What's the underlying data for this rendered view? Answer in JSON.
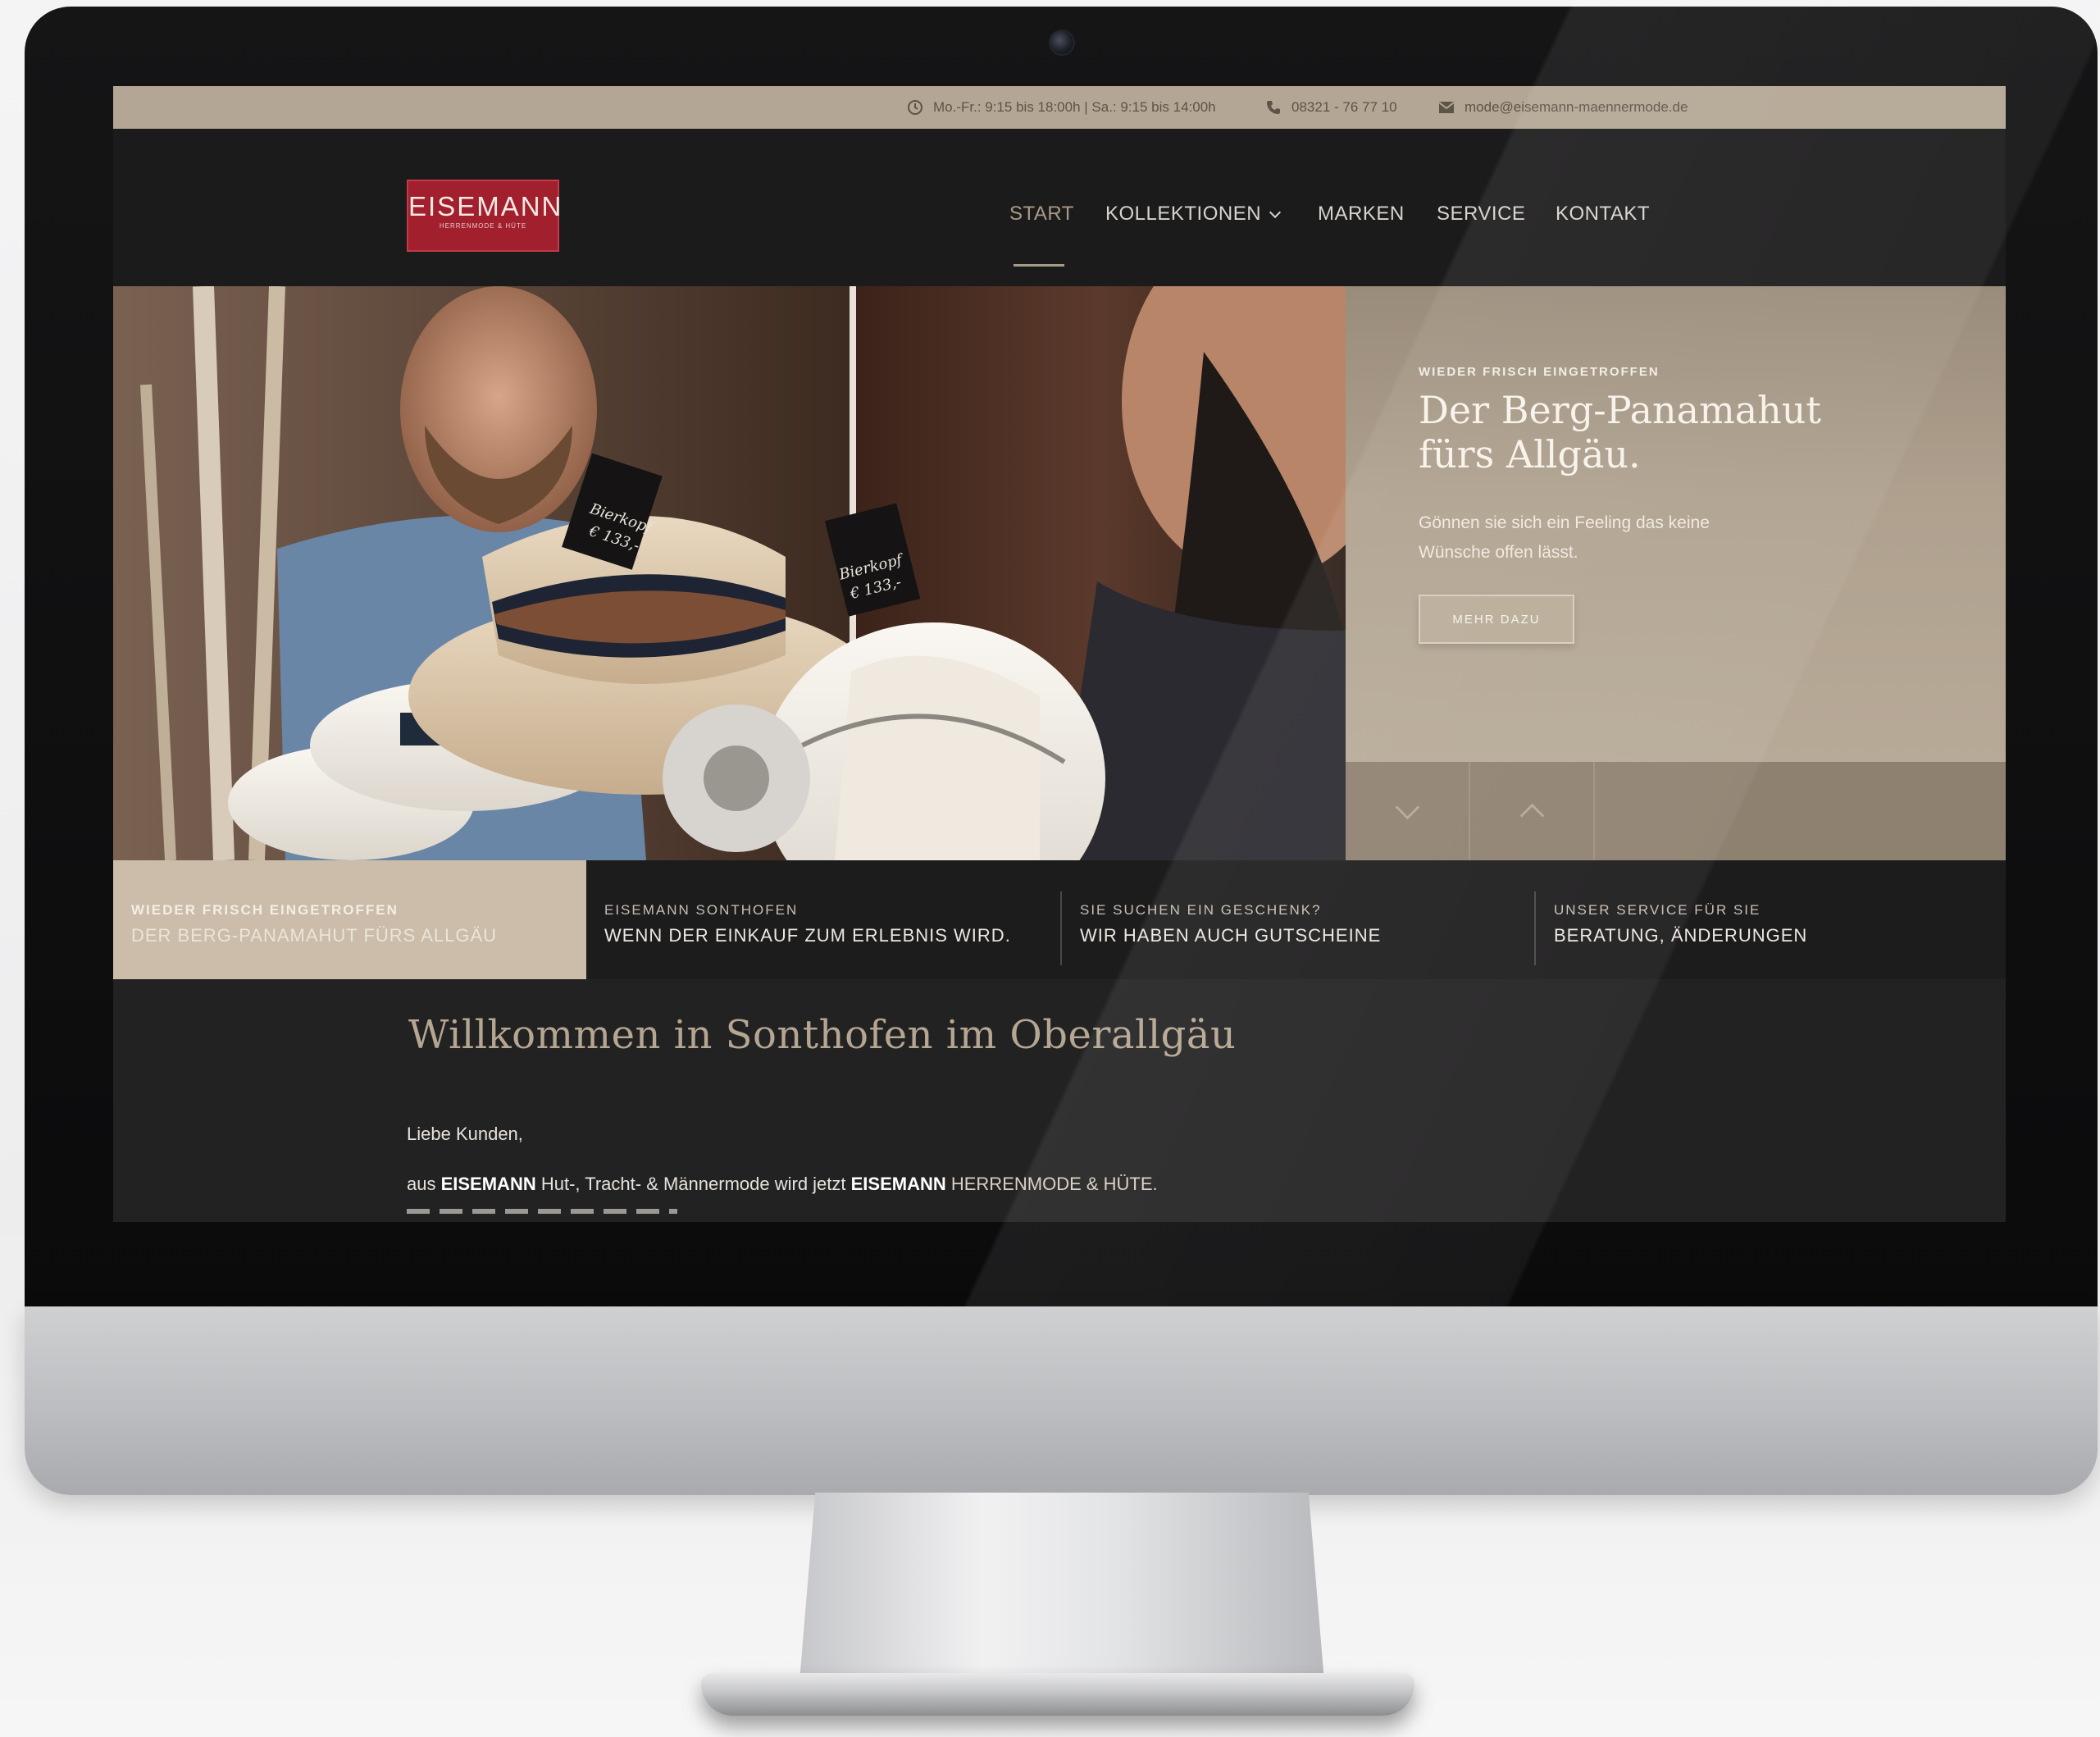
{
  "topbar": {
    "hours": "Mo.-Fr.: 9:15 bis 18:00h | Sa.: 9:15 bis 14:00h",
    "phone": "08321 - 76 77 10",
    "email": "mode@eisemann-maennermode.de"
  },
  "logo": {
    "name": "EISEMANN",
    "tagline": "HERRENMODE & HÜTE"
  },
  "nav": {
    "items": [
      {
        "label": "START",
        "active": true
      },
      {
        "label": "KOLLEKTIONEN",
        "has_dropdown": true
      },
      {
        "label": "MARKEN"
      },
      {
        "label": "SERVICE"
      },
      {
        "label": "KONTAKT"
      }
    ]
  },
  "hero": {
    "eyebrow": "WIEDER FRISCH EINGETROFFEN",
    "title_line1": "Der Berg-Panamahut",
    "title_line2": "fürs Allgäu.",
    "text": "Gönnen sie sich ein Feeling das keine Wünsche offen lässt.",
    "button_label": "MEHR DAZU",
    "price_tag_1": "Bierkopf € 133,-",
    "price_tag_2": "Bierkopf € 133,-"
  },
  "teasers": [
    {
      "small": "WIEDER FRISCH EINGETROFFEN",
      "big": "DER BERG-PANAMAHUT FÜRS ALLGÄU",
      "active": true
    },
    {
      "small": "EISEMANN SONTHOFEN",
      "big": "WENN DER EINKAUF ZUM ERLEBNIS WIRD."
    },
    {
      "small": "SIE SUCHEN EIN GESCHENK?",
      "big": "WIR HABEN AUCH GUTSCHEINE"
    },
    {
      "small": "UNSER SERVICE FÜR SIE",
      "big": "BERATUNG, ÄNDERUNGEN"
    }
  ],
  "welcome": {
    "title": "Willkommen in Sonthofen im Oberallgäu",
    "p1": "Liebe Kunden,",
    "p2_prefix": "aus ",
    "p2_brand1": "EISEMANN",
    "p2_mid": " Hut-, Tracht- & Männermode wird jetzt ",
    "p2_brand2": "EISEMANN",
    "p2_suffix": " HERRENMODE & HÜTE."
  },
  "colors": {
    "topbar": "#b3a694",
    "accent_beige": "#b5a692",
    "logo_red": "#a21f2e",
    "nav_bg": "#1c1b1c",
    "page_bg": "#232223"
  }
}
